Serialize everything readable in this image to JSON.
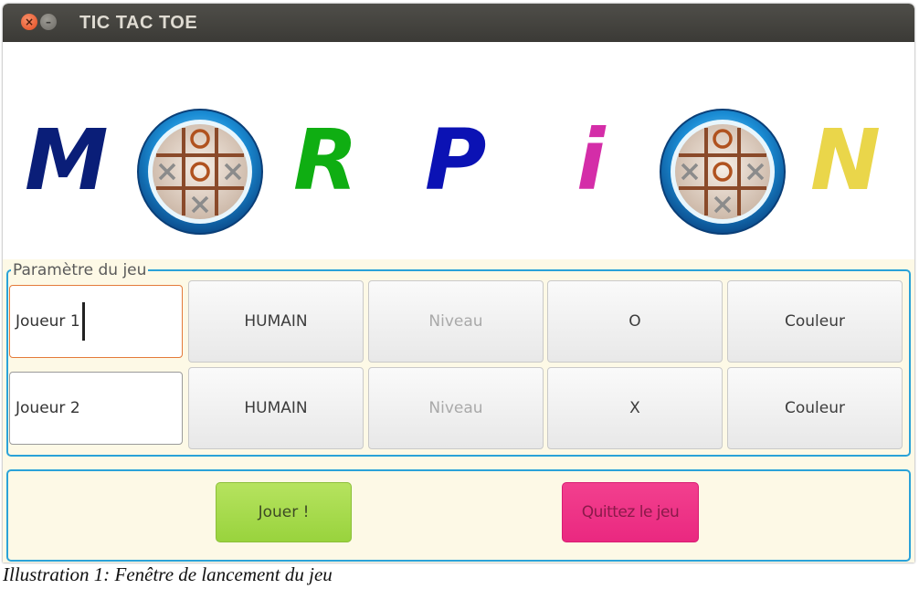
{
  "window": {
    "title": "TIC TAC TOE",
    "close_icon": "×",
    "minimize_icon": "–"
  },
  "banner": {
    "letters": [
      {
        "char": "M",
        "color": "#0a1e78"
      },
      {
        "char": "R",
        "color": "#0fae12"
      },
      {
        "char": "P",
        "color": "#0b12b4"
      },
      {
        "char": "i",
        "color": "#d42da8"
      },
      {
        "char": "N",
        "color": "#ead64a"
      }
    ],
    "logo_icon": "tic-tac-toe-logo",
    "logo_grid": [
      "",
      "O",
      "",
      "X",
      "O",
      "X",
      "",
      "X",
      ""
    ]
  },
  "settings": {
    "legend": "Paramètre du jeu",
    "players": [
      {
        "name": "Joueur 1",
        "type": "HUMAIN",
        "level": "Niveau",
        "symbol": "O",
        "color": "Couleur"
      },
      {
        "name": "Joueur 2",
        "type": "HUMAIN",
        "level": "Niveau",
        "symbol": "X",
        "color": "Couleur"
      }
    ]
  },
  "actions": {
    "play": "Jouer !",
    "quit": "Quittez le jeu"
  },
  "caption": "Illustration 1: Fenêtre de lancement du jeu",
  "colors": {
    "accent": "#2aa2d8",
    "play": "#a7db4c",
    "quit": "#ee3388",
    "background": "#fdf9e6"
  }
}
